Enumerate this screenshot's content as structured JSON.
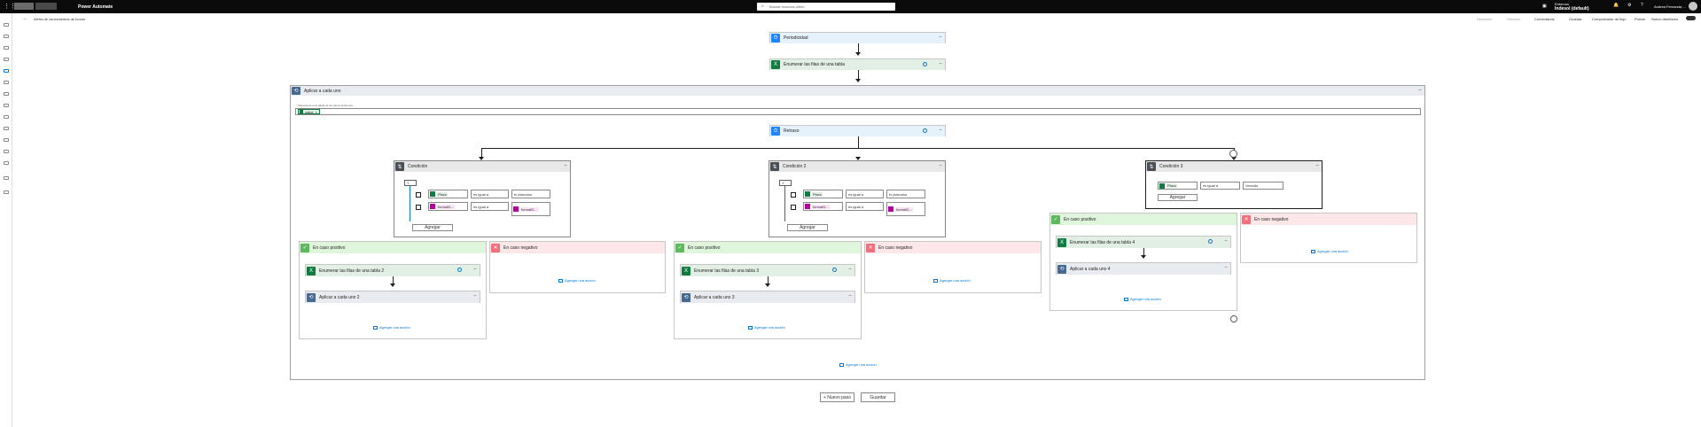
{
  "topbar": {
    "brand": "Power Automate",
    "search_placeholder": "Buscar recursos útiles",
    "env_label": "Entornos",
    "env_value": "Indesol (default)",
    "user_name": "Andrea Fernanda ..."
  },
  "cmdbar": {
    "back_label": "Alerta de vencimientos de bonos",
    "undo": "Deshacer",
    "redo": "Rehacer",
    "comments": "Comentarios",
    "save": "Guardar",
    "checker": "Comprobador de flujo",
    "test": "Probar",
    "new_designer": "Nuevo diseñador"
  },
  "flow": {
    "recurrence": "Periodicidad",
    "list_rows": "Enumerar las filas de una tabla",
    "apply_each": "Aplicar a cada uno",
    "apply_each_hint": "* Seleccionar una salida de los pasos anteriores",
    "apply_each_token": "value",
    "delay": "Retraso",
    "cond1": "Condición",
    "cond2": "Condición 2",
    "cond3": "Condición 3",
    "and_op": "Y",
    "token_plazo": "Plazo",
    "token_formatdate": "formatD...",
    "is_equal": "es igual a",
    "val_plazo": "fx plazonso",
    "add_btn": "Agregar",
    "if_yes": "En caso positivo",
    "if_no": "En caso negativo",
    "list_rows_2": "Enumerar las filas de una tabla 2",
    "apply_each_2": "Aplicar a cada uno 2",
    "list_rows_3": "Enumerar las filas de una tabla 3",
    "apply_each_3": "Aplicar a cada uno 3",
    "list_rows_4": "Enumerar las filas de una tabla 4",
    "apply_each_4": "Aplicar a cada uno 4",
    "add_action": "Agregar una acción",
    "val_vencido": "Vencido",
    "new_step": "+ Nuevo paso",
    "save_bottom": "Guardar"
  }
}
